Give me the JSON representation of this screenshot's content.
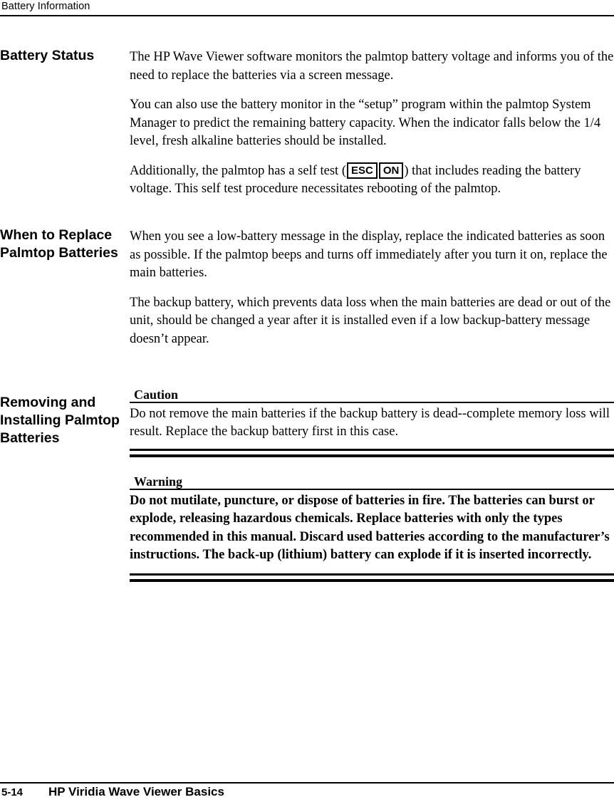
{
  "header": {
    "title": "Battery Information"
  },
  "sections": [
    {
      "heading": "Battery Status",
      "paragraphs": [
        "The HP Wave Viewer software monitors the palmtop battery voltage and informs you of the need to replace the batteries via a screen message.",
        "You can also use the battery monitor in the “setup” program within the palmtop System Manager to predict the remaining battery capacity. When the indicator falls below the 1/4 level, fresh alkaline batteries should be installed."
      ],
      "selftest": {
        "before": "Additionally, the palmtop has a self test (",
        "key1": "ESC",
        "key2": "ON",
        "after": ") that includes reading the battery voltage. This self test procedure necessitates rebooting of the palmtop."
      }
    },
    {
      "heading": "When to Replace Palmtop Batteries",
      "paragraphs": [
        "When you see a low-battery message in the display, replace the indicated batteries as soon as possible. If the palmtop beeps and turns off immediately after you turn it on, replace the main batteries.",
        "The backup battery, which prevents data loss when the main batteries are dead or out of the unit, should be changed a year after it is installed even if a low backup-battery message doesn’t appear."
      ]
    },
    {
      "heading": "Removing and Installing Palmtop Batteries",
      "notes": [
        {
          "title": "Caution",
          "body": "Do not remove the main batteries if the backup battery is dead--complete memory loss will result. Replace the backup battery first in this case."
        },
        {
          "title": "Warning",
          "body": "Do not mutilate, puncture, or dispose of batteries in fire. The batteries can burst or explode, releasing hazardous chemicals. Replace batteries with only the types recommended in this manual. Discard used batteries according to the manufacturer’s instructions. The back-up (lithium) battery can explode if it is inserted incorrectly."
        }
      ]
    }
  ],
  "footer": {
    "page_number": "5-14",
    "book_title": "HP Viridia Wave Viewer Basics"
  }
}
